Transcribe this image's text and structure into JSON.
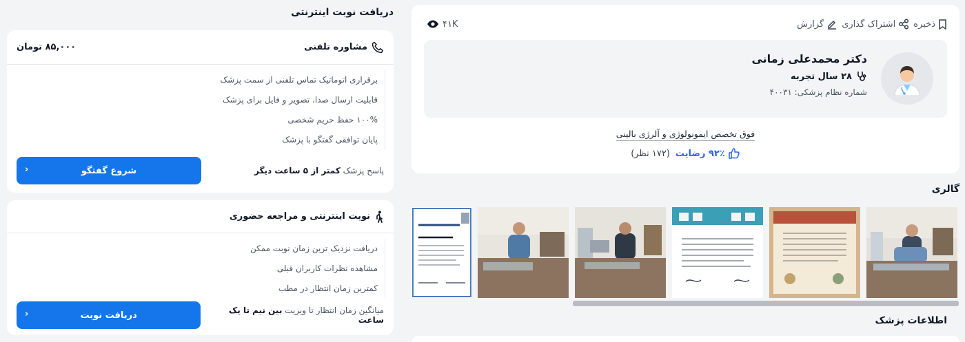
{
  "profile": {
    "actions": {
      "save": "ذخیره",
      "share": "اشتراک گذاری",
      "report": "گزارش"
    },
    "views": "۴۱K",
    "doctor_name": "دکتر محمدعلی زمانی",
    "experience": "۲۸ سال تجربه",
    "registration": "شماره نظام پزشکی: ۴۰۰۳۱",
    "specialty": "فوق تخصص ایمونولوژی و آلرژی بالینی",
    "satisfaction": "۹۲٪ رضایت",
    "reviews": "(۱۷۲ نظر)"
  },
  "gallery": {
    "title": "گالری"
  },
  "doctor_info": {
    "title": "اطلاعات پزشک"
  },
  "appointment": {
    "title": "دریافت نوبت اینترنتی",
    "phone": {
      "title": "مشاوره تلفنی",
      "price": "۸۵,۰۰۰ تومان",
      "features": [
        "برقراری اتوماتیک تماس تلفنی از سمت پزشک",
        "قابلیت ارسال صدا، تصویر و فایل برای پزشک",
        "۱۰۰% حفظ حریم شخصی",
        "پایان توافقی گفتگو با پزشک"
      ],
      "note_prefix": "پاسخ پزشک",
      "note_value": "کمتر از ۵ ساعت دیگر",
      "button": "شروع گفتگو"
    },
    "visit": {
      "title": "نوبت اینترنتی و مراجعه حضوری",
      "features": [
        "دریافت نزدیک ترین زمان نوبت ممکن",
        "مشاهده نظرات کاربران قبلی",
        "کمترین زمان انتظار در مطب"
      ],
      "note_prefix": "میانگین زمان انتظار تا ویزیت",
      "note_value": "بین نیم تا یک ساعت",
      "button": "دریافت نوبت"
    }
  },
  "colors": {
    "primary": "#1575ea",
    "link": "#2563eb"
  }
}
